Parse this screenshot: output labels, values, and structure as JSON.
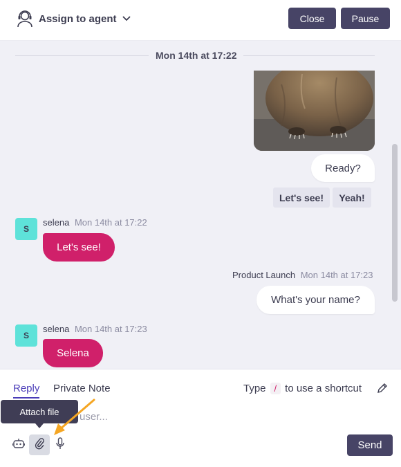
{
  "header": {
    "assign_label": "Assign to agent",
    "close_label": "Close",
    "pause_label": "Pause"
  },
  "conversation": {
    "date_separator": "Mon 14th at 17:22",
    "messages": [
      {
        "direction": "outgoing",
        "type": "image"
      },
      {
        "direction": "outgoing",
        "text": "Ready?"
      },
      {
        "direction": "incoming",
        "sender": "selena",
        "avatar_initial": "S",
        "time": "Mon 14th at 17:22",
        "text": "Let's see!"
      },
      {
        "direction": "outgoing",
        "sender": "Product Launch",
        "time": "Mon 14th at 17:23",
        "text": "What's your name?"
      },
      {
        "direction": "incoming",
        "sender": "selena",
        "avatar_initial": "S",
        "time": "Mon 14th at 17:23",
        "text": "Selena"
      }
    ],
    "quick_replies": [
      "Let's see!",
      "Yeah!"
    ]
  },
  "composer": {
    "tabs": [
      "Reply",
      "Private Note"
    ],
    "active_tab": "Reply",
    "shortcut_hint": {
      "prefix": "Type",
      "key": "/",
      "suffix": "to use a shortcut"
    },
    "placeholder_visible": "user...",
    "tooltip": "Attach file",
    "send_label": "Send",
    "tools": [
      "bot-icon",
      "paperclip-icon",
      "microphone-icon"
    ]
  },
  "colors": {
    "primary_dark": "#474466",
    "incoming_bubble": "#d0206a",
    "avatar_bg": "#5ee2d9",
    "active_tab": "#4a3cb8",
    "annotation_arrow": "#f5a623"
  }
}
